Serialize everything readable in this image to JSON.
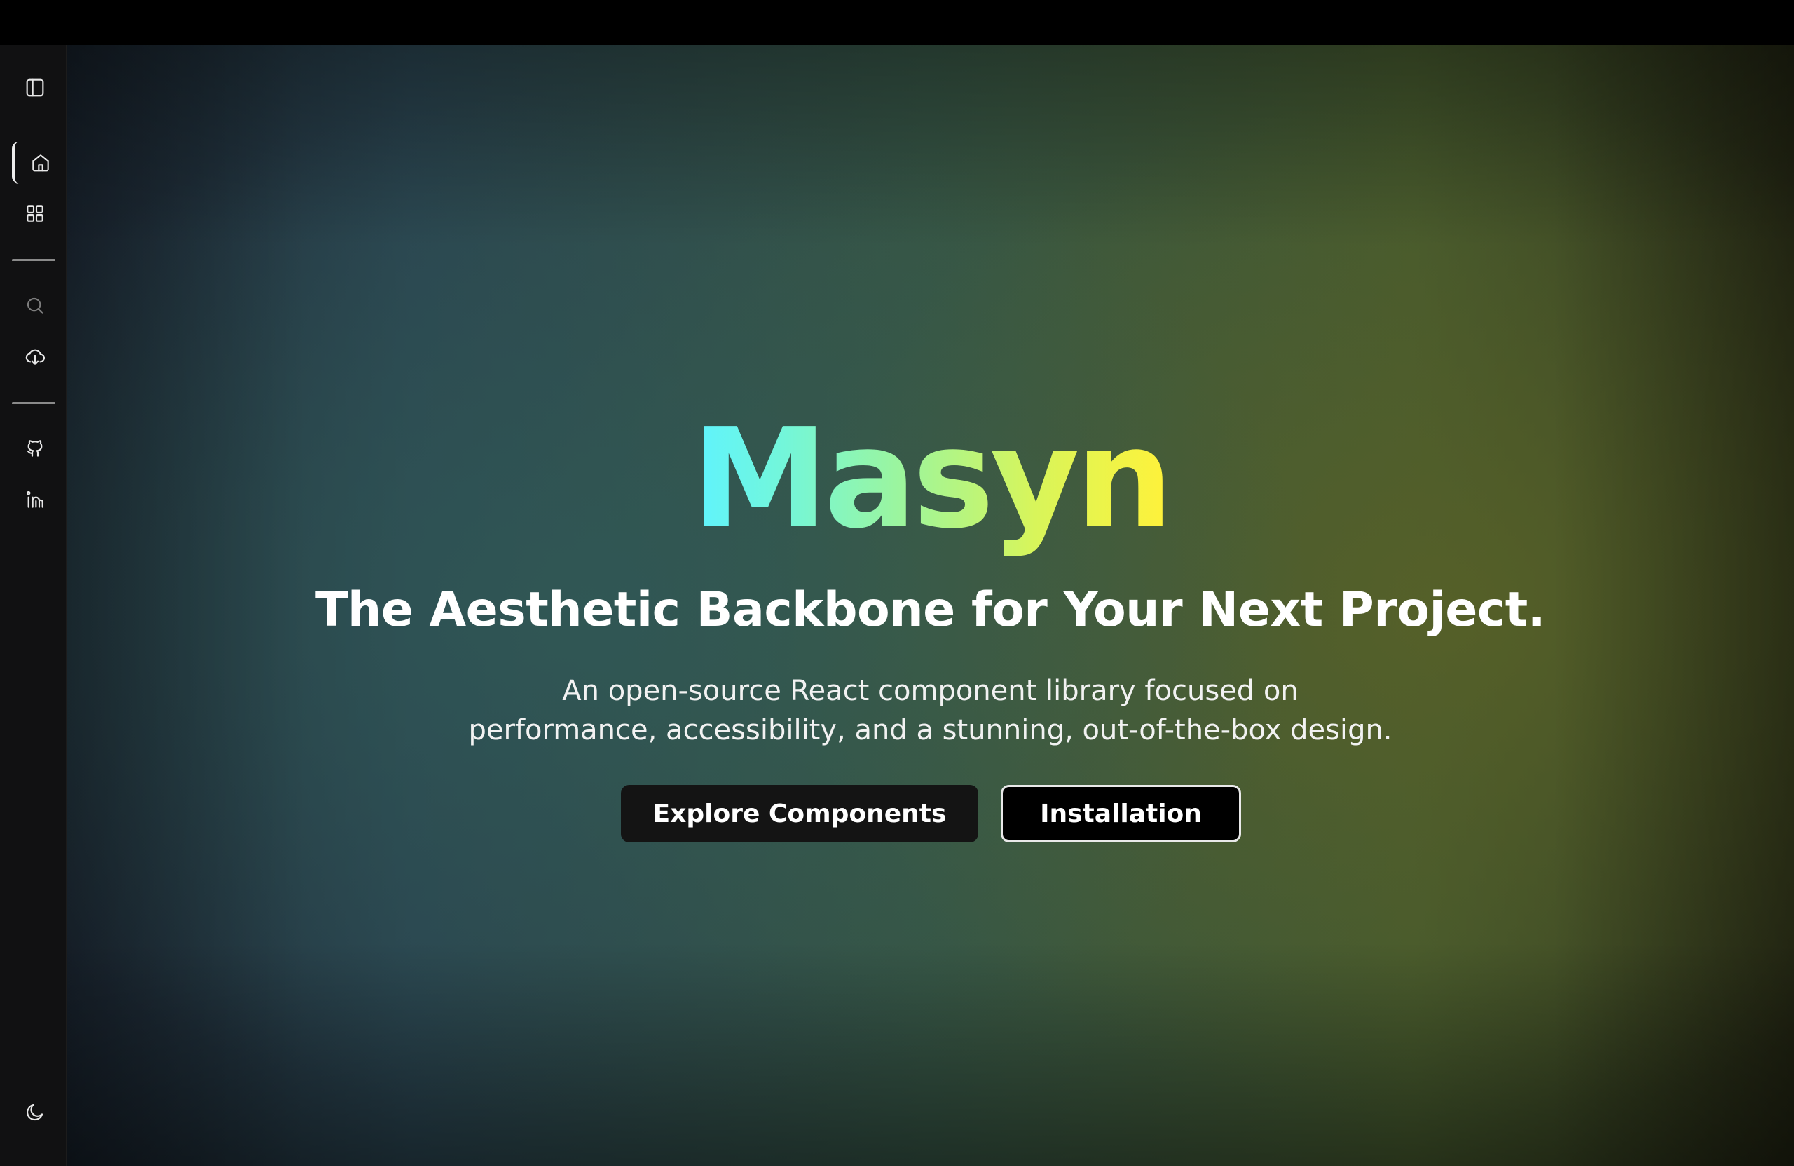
{
  "sidebar": {
    "items": [
      {
        "icon": "sidebar-toggle-icon"
      },
      {
        "icon": "home-icon",
        "active": true
      },
      {
        "icon": "grid-icon"
      },
      {
        "icon": "search-icon"
      },
      {
        "icon": "cloud-download-icon"
      },
      {
        "icon": "github-icon"
      },
      {
        "icon": "linkedin-icon"
      },
      {
        "icon": "moon-icon"
      }
    ]
  },
  "hero": {
    "brand": "Masyn",
    "tagline": "The Aesthetic Backbone for Your Next Project.",
    "description_line1": "An open-source React component library focused on",
    "description_line2": "performance, accessibility, and a stunning, out-of-the-box design.",
    "primary_button": "Explore Components",
    "secondary_button": "Installation"
  },
  "colors": {
    "brand_gradient": [
      "#5ef4ff",
      "#9ef59a",
      "#fff23a"
    ],
    "primary_button_bg": "#141414",
    "secondary_button_border": "#e9e9e9"
  }
}
